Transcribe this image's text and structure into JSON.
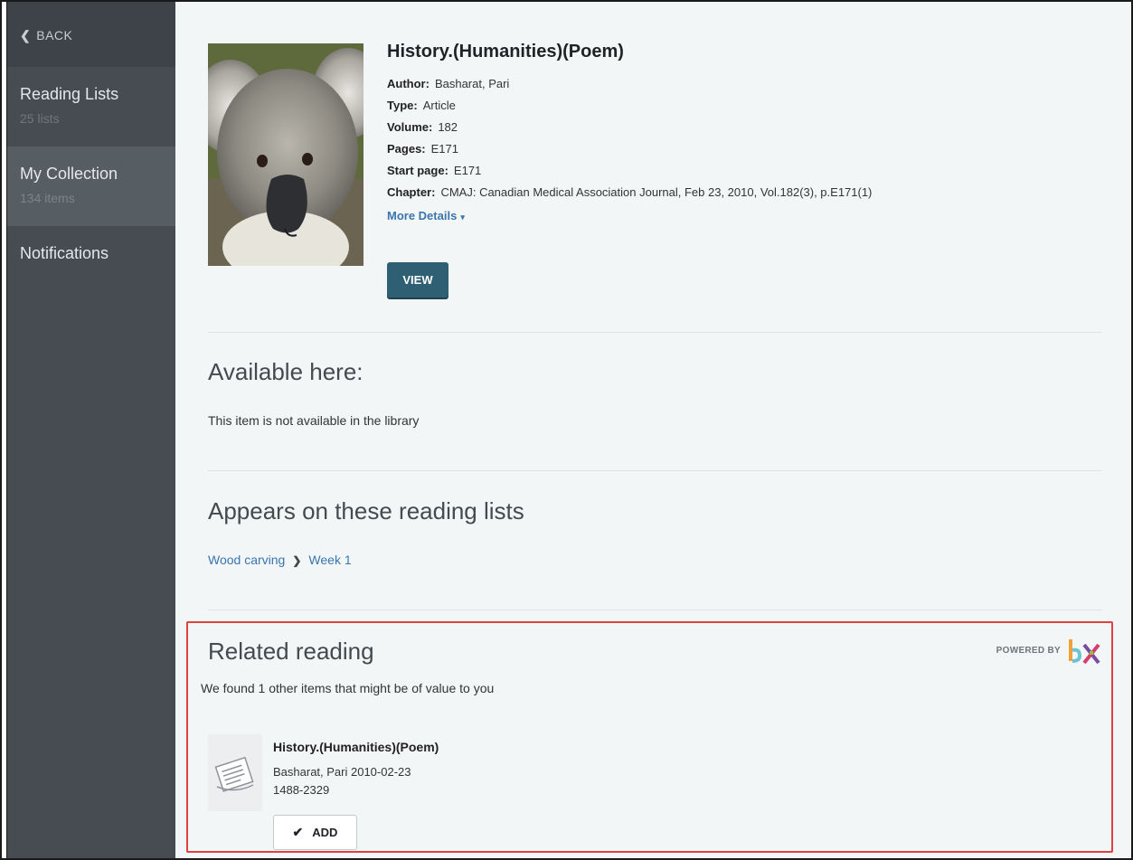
{
  "sidebar": {
    "back_label": "BACK",
    "items": [
      {
        "label": "Reading Lists",
        "sub": "25 lists"
      },
      {
        "label": "My Collection",
        "sub": "134 items"
      },
      {
        "label": "Notifications",
        "sub": ""
      }
    ]
  },
  "item": {
    "title": "History.(Humanities)(Poem)",
    "author_label": "Author:",
    "author": "Basharat, Pari",
    "type_label": "Type:",
    "type": "Article",
    "volume_label": "Volume:",
    "volume": "182",
    "pages_label": "Pages:",
    "pages": "E171",
    "start_page_label": "Start page:",
    "start_page": "E171",
    "chapter_label": "Chapter:",
    "chapter": "CMAJ: Canadian Medical Association Journal, Feb 23, 2010, Vol.182(3), p.E171(1)",
    "more_details": "More Details",
    "view_button": "VIEW"
  },
  "availability": {
    "title": "Available here:",
    "message": "This item is not available in the library"
  },
  "reading_lists": {
    "title": "Appears on these reading lists",
    "crumbs": [
      "Wood carving",
      "Week 1"
    ]
  },
  "related": {
    "title": "Related reading",
    "subtitle": "We found 1 other items that might be of value to you",
    "powered_by": "POWERED BY",
    "items": [
      {
        "title": "History.(Humanities)(Poem)",
        "byline": "Basharat, Pari 2010-02-23",
        "issn": "1488-2329",
        "add_label": "ADD"
      }
    ]
  },
  "colors": {
    "sidebar": "#464c52",
    "link": "#3a75ad",
    "view_button": "#2e5f72",
    "highlight_border": "#e0403f"
  }
}
